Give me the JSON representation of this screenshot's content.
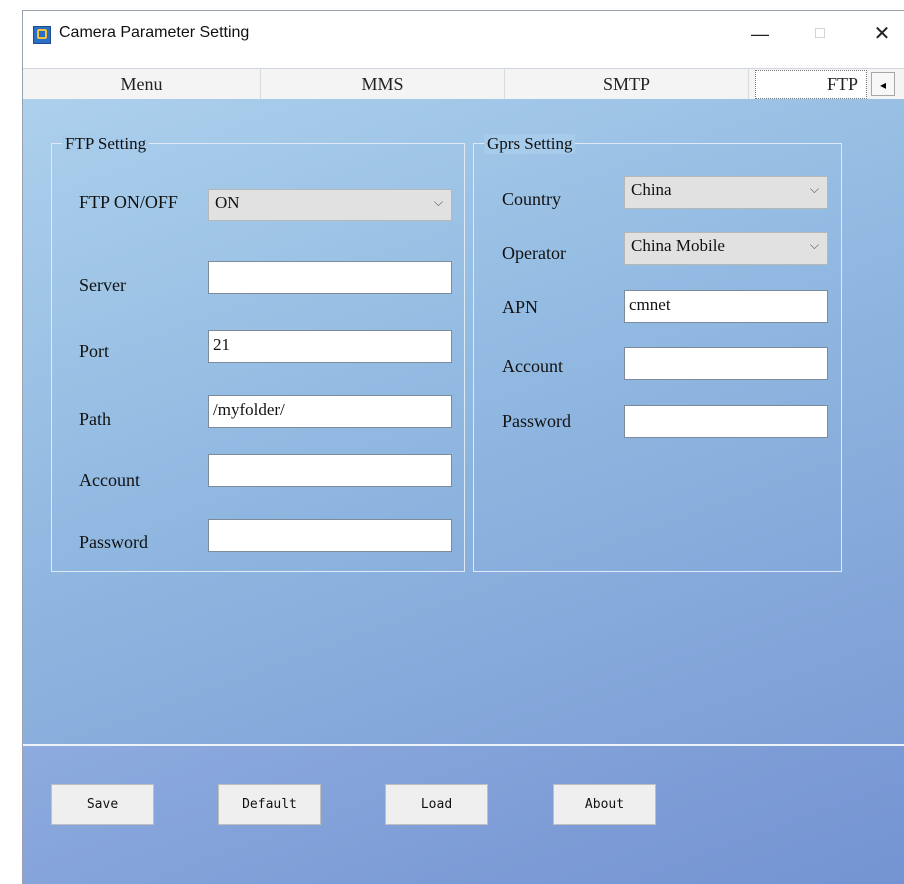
{
  "window": {
    "title": "Camera Parameter Setting"
  },
  "tabs": [
    {
      "label": "Menu"
    },
    {
      "label": "MMS"
    },
    {
      "label": "SMTP"
    },
    {
      "label": "FTP",
      "selected": true
    }
  ],
  "ftp_setting": {
    "legend": "FTP Setting",
    "on_off_label": "FTP ON/OFF",
    "on_off_value": "ON",
    "server_label": "Server",
    "server_value": "",
    "port_label": "Port",
    "port_value": "21",
    "path_label": "Path",
    "path_value": "/myfolder/",
    "account_label": "Account",
    "account_value": "",
    "password_label": "Password",
    "password_value": ""
  },
  "gprs_setting": {
    "legend": "Gprs Setting",
    "country_label": "Country",
    "country_value": "China",
    "operator_label": "Operator",
    "operator_value": "China Mobile",
    "apn_label": "APN",
    "apn_value": "cmnet",
    "account_label": "Account",
    "account_value": "",
    "password_label": "Password",
    "password_value": ""
  },
  "buttons": {
    "save": "Save",
    "default": "Default",
    "load": "Load",
    "about": "About"
  },
  "window_controls": {
    "minimize": "—",
    "maximize": "□",
    "close": "✕",
    "tab_scroll": "◂"
  },
  "colors": {
    "content_bg": "#9cc3e8",
    "footer_bg": "#7f9fd8"
  }
}
